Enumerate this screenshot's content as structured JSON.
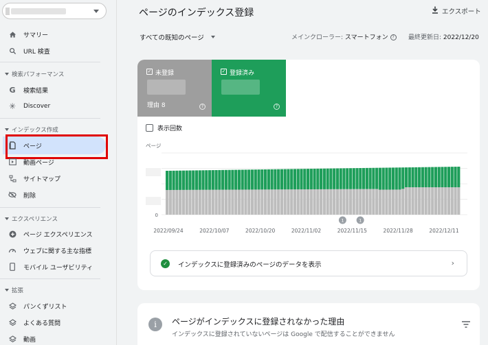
{
  "sidebar": {
    "property_selector": "",
    "items": [
      {
        "id": "summary",
        "label": "サマリー",
        "icon": "home-icon"
      },
      {
        "id": "url",
        "label": "URL 検査",
        "icon": "search-icon"
      }
    ],
    "sections": [
      {
        "title": "検索パフォーマンス",
        "items": [
          {
            "label": "検索結果",
            "icon": "google-icon"
          },
          {
            "label": "Discover",
            "icon": "asterisk-icon"
          }
        ]
      },
      {
        "title": "インデックス作成",
        "items": [
          {
            "label": "ページ",
            "icon": "page-icon"
          },
          {
            "label": "動画ページ",
            "icon": "video-icon"
          },
          {
            "label": "サイトマップ",
            "icon": "sitemap-icon"
          },
          {
            "label": "削除",
            "icon": "eye-off-icon"
          }
        ]
      },
      {
        "title": "エクスペリエンス",
        "items": [
          {
            "label": "ページ エクスペリエンス",
            "icon": "plus-circle-icon"
          },
          {
            "label": "ウェブに関する主な指標",
            "icon": "gauge-icon"
          },
          {
            "label": "モバイル ユーザビリティ",
            "icon": "phone-icon"
          }
        ]
      },
      {
        "title": "拡張",
        "items": [
          {
            "label": "パンくずリスト",
            "icon": "layers-icon"
          },
          {
            "label": "よくある質問",
            "icon": "layers-icon"
          },
          {
            "label": "動画",
            "icon": "layers-icon"
          }
        ]
      }
    ]
  },
  "header": {
    "title": "ページのインデックス登録",
    "export_label": "エクスポート"
  },
  "filter": {
    "scope_label": "すべての既知のページ",
    "crawler_label": "メインクローラー:",
    "crawler_value": "スマートフォン",
    "updated_label": "最終更新日:",
    "updated_value": "2022/12/20"
  },
  "tiles": {
    "not_indexed": {
      "label": "未登録",
      "reason": "理由 8",
      "color": "#9e9e9e"
    },
    "indexed": {
      "label": "登録済み",
      "color": "#1e9e5a"
    }
  },
  "impressions_label": "表示回数",
  "chart_data": {
    "type": "bar",
    "stacked": true,
    "ylabel": "ページ",
    "y_tick_labels": [
      "0"
    ],
    "x_tick_labels": [
      "2022/09/24",
      "2022/10/07",
      "2022/10/20",
      "2022/11/02",
      "2022/11/15",
      "2022/11/28",
      "2022/12/11"
    ],
    "annotation_labels": [
      "1",
      "1"
    ],
    "annotation_positions": [
      0.6,
      0.66
    ],
    "bar_count": 90,
    "series": [
      {
        "name": "未登録",
        "color": "#bdbdbd",
        "values": []
      },
      {
        "name": "登録済み",
        "color": "#1e9e5a",
        "values": []
      }
    ]
  },
  "link": {
    "label": "インデックスに登録済みのページのデータを表示"
  },
  "reasons_card": {
    "title": "ページがインデックスに登録されなかった理由",
    "subtitle": "インデックスに登録されていないページは Google で配信することができません"
  }
}
